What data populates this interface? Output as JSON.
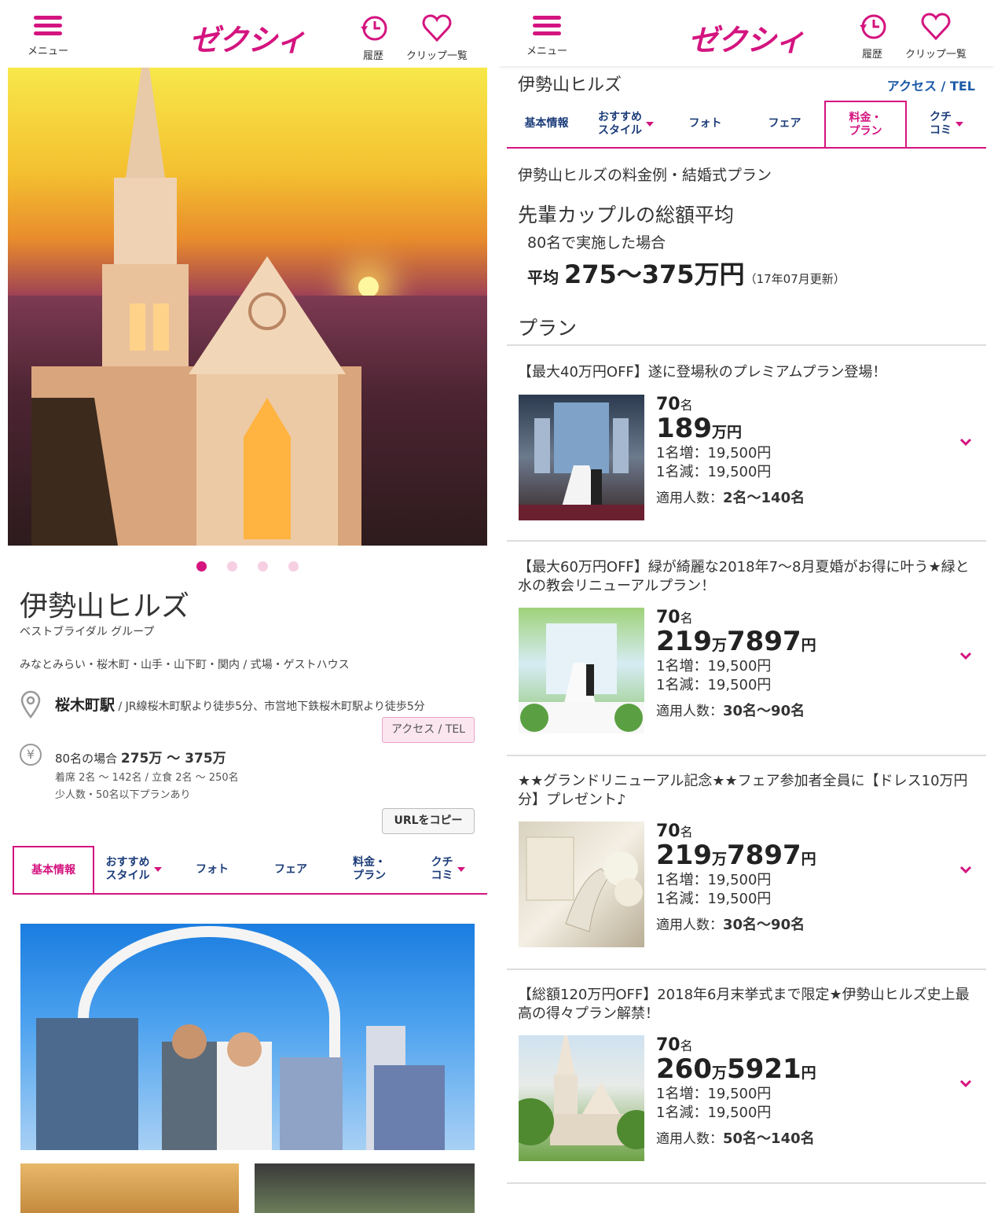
{
  "header": {
    "menu_label": "メニュー",
    "logo": "ゼクシィ",
    "history_label": "履歴",
    "clip_label": "クリップ一覧",
    "brand_color": "#d4147f"
  },
  "left": {
    "venue_name": "伊勢山ヒルズ",
    "group": "ベストブライダル グループ",
    "area": "みなとみらい・桜木町・山手・山下町・関内 / 式場・ゲストハウス",
    "station_name": "桜木町駅",
    "station_detail": " / JR線桜木町駅より徒歩5分、市営地下鉄桜木町駅より徒歩5分",
    "access_button": "アクセス / TEL",
    "price_prefix": "80名の場合 ",
    "price_range": "275万 〜 375万",
    "seating": "着席 2名 〜 142名 / 立食 2名 〜 250名",
    "small_note": "少人数・50名以下プランあり",
    "url_button": "URLをコピー",
    "carousel": {
      "count": 4,
      "active": 1
    }
  },
  "tabs": {
    "basic": "基本情報",
    "style_l1": "おすすめ",
    "style_l2": "スタイル",
    "photo": "フォト",
    "fair": "フェア",
    "price_l1": "料金・",
    "price_l2": "プラン",
    "review_l1": "クチ",
    "review_l2": "コミ"
  },
  "right": {
    "venue_name": "伊勢山ヒルズ",
    "access_link": "アクセス / TEL",
    "subtitle": "伊勢山ヒルズの料金例・結婚式プラン",
    "avg_heading": "先輩カップルの総額平均",
    "avg_condition": "80名で実施した場合",
    "avg_label": "平均 ",
    "avg_value": "275〜375万円",
    "avg_updated": "（17年07月更新）",
    "plan_heading": "プラン",
    "plans": [
      {
        "title": "【最大40万円OFF】遂に登場秋のプレミアムプラン登場！",
        "people": "70",
        "people_unit": "名",
        "price_man": "189",
        "price_rest": "",
        "unit": "円",
        "add": "1名増：19,500円",
        "sub": "1名減：19,500円",
        "range_label": "適用人数：",
        "range": "2名〜140名"
      },
      {
        "title": "【最大60万円OFF】緑が綺麗な2018年7〜8月夏婚がお得に叶う★緑と水の教会リニューアルプラン！",
        "people": "70",
        "people_unit": "名",
        "price_man": "219",
        "price_rest": "7897",
        "unit": "円",
        "add": "1名増：19,500円",
        "sub": "1名減：19,500円",
        "range_label": "適用人数：",
        "range": "30名〜90名"
      },
      {
        "title": "★★グランドリニューアル記念★★フェア参加者全員に【ドレス10万円分】プレゼント♪",
        "people": "70",
        "people_unit": "名",
        "price_man": "219",
        "price_rest": "7897",
        "unit": "円",
        "add": "1名増：19,500円",
        "sub": "1名減：19,500円",
        "range_label": "適用人数：",
        "range": "30名〜90名"
      },
      {
        "title": "【総額120万円OFF】2018年6月末挙式まで限定★伊勢山ヒルズ史上最高の得々プラン解禁！",
        "people": "70",
        "people_unit": "名",
        "price_man": "260",
        "price_rest": "5921",
        "unit": "円",
        "add": "1名増：19,500円",
        "sub": "1名減：19,500円",
        "range_label": "適用人数：",
        "range": "50名〜140名"
      }
    ],
    "man_unit": "万"
  }
}
